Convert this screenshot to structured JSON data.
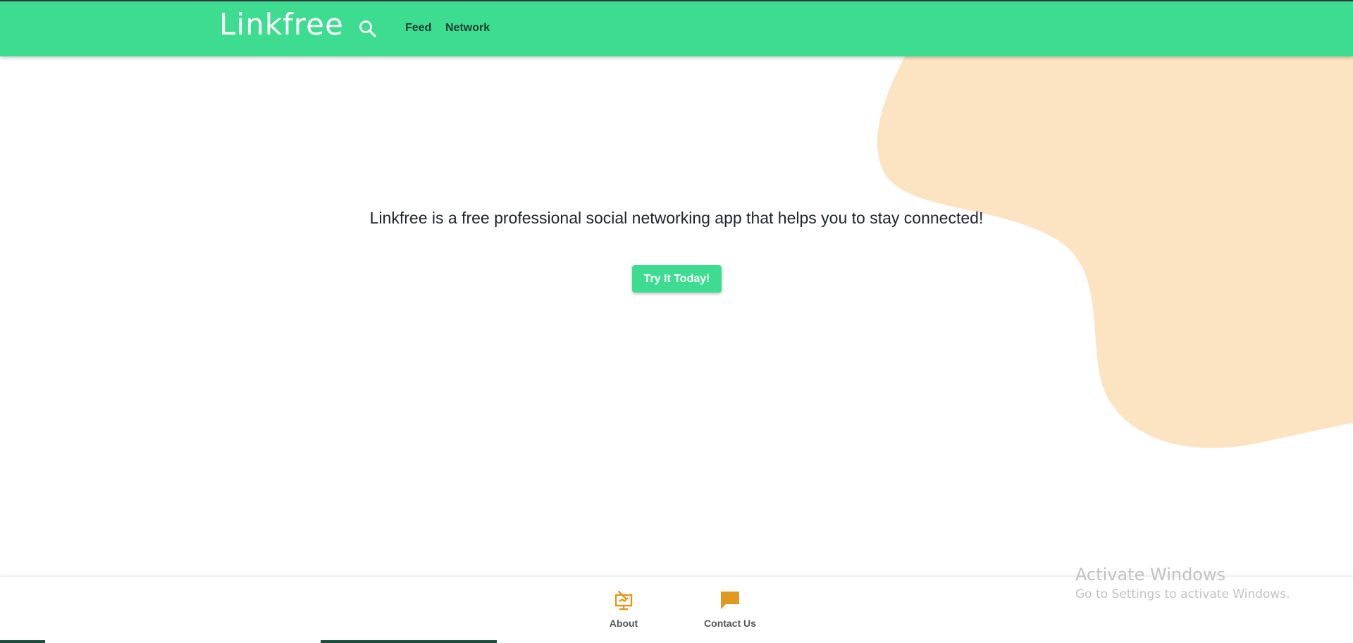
{
  "brand": {
    "name": "Linkfree"
  },
  "nav": {
    "links": [
      {
        "label": "Feed"
      },
      {
        "label": "Network"
      }
    ]
  },
  "hero": {
    "tagline": "Linkfree is a free professional social networking app that helps you to stay connected!",
    "cta_label": "Try It Today!"
  },
  "footer": {
    "items": [
      {
        "label": "About",
        "icon": "presentation-icon"
      },
      {
        "label": "Contact Us",
        "icon": "chat-bubble-icon"
      }
    ]
  },
  "watermark": {
    "title": "Activate Windows",
    "subtitle": "Go to Settings to activate Windows."
  },
  "colors": {
    "brand_green": "#3ddc91",
    "blob_peach": "#fce3c1",
    "footer_icon_orange": "#e0981f",
    "nav_text": "#1f3a2f"
  }
}
